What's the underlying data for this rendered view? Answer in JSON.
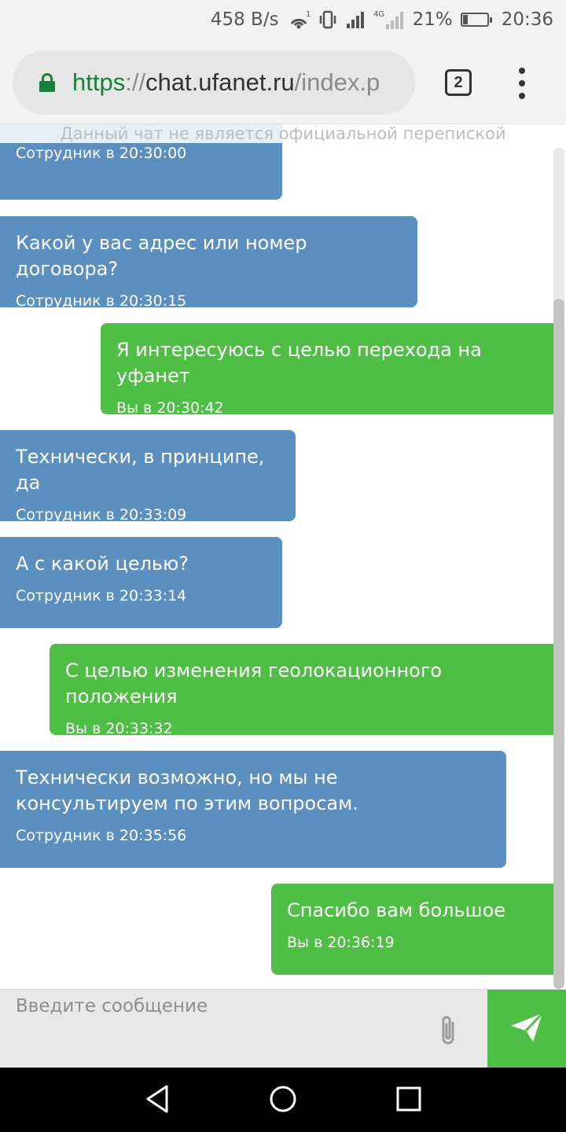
{
  "status_bar": {
    "net_speed": "458 B/s",
    "hotspot_badge": "1",
    "network_type": "4G",
    "battery": "21%",
    "battery_level": 0.21,
    "time": "20:36"
  },
  "browser": {
    "url_scheme": "https",
    "url_sep": "://",
    "url_host": "chat.ufanet.ru",
    "url_path": "/index.p",
    "tab_count": "2"
  },
  "chat": {
    "disclaimer": "Данный чат не является официальной перепиской",
    "messages": [
      {
        "role": "agent",
        "text": "",
        "meta": "Сотрудник в 20:30:00"
      },
      {
        "role": "agent",
        "text": "Какой у вас адрес или номер договора?",
        "meta": "Сотрудник в 20:30:15"
      },
      {
        "role": "user",
        "text": "Я интересуюсь с целью перехода на уфанет",
        "meta": "Вы в 20:30:42"
      },
      {
        "role": "agent",
        "text": "Технически, в принципе, да",
        "meta": "Сотрудник в 20:33:09"
      },
      {
        "role": "agent",
        "text": "А с какой целью?",
        "meta": "Сотрудник в 20:33:14"
      },
      {
        "role": "user",
        "text": "С целью изменения геолокационного положения",
        "meta": "Вы в 20:33:32"
      },
      {
        "role": "agent",
        "text": "Технически возможно, но мы не консультируем по этим вопросам.",
        "meta": "Сотрудник в 20:35:56"
      },
      {
        "role": "user",
        "text": "Спасибо вам большое",
        "meta": "Вы в 20:36:19"
      }
    ]
  },
  "composer": {
    "placeholder": "Введите сообщение",
    "value": ""
  },
  "colors": {
    "agent_bubble": "#5b8fbf",
    "user_bubble": "#4fbe45",
    "send_button": "#4fbe45",
    "secure_green": "#188038"
  },
  "icons": {
    "lock": "lock-icon",
    "attach": "paperclip-icon",
    "send": "paper-plane-icon",
    "back": "back-triangle-icon",
    "home": "home-circle-icon",
    "recents": "recents-square-icon"
  }
}
